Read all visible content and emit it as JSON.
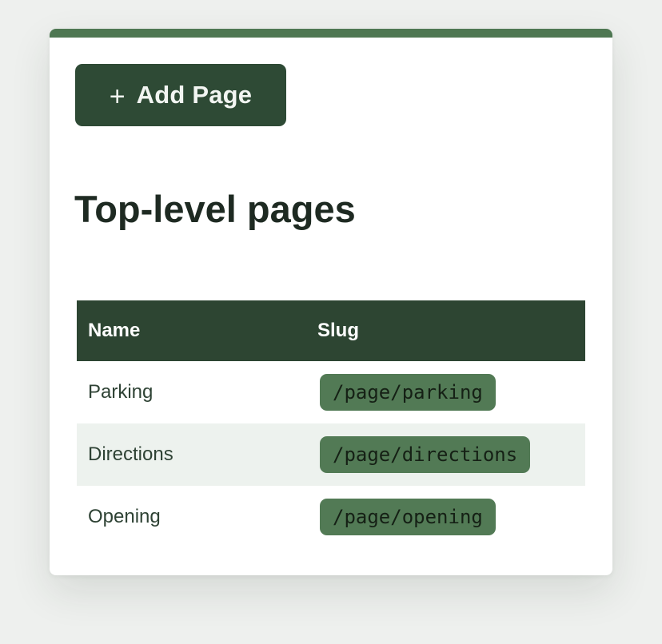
{
  "toolbar": {
    "add_icon": "plus-icon",
    "add_icon_glyph": "+",
    "add_label": "Add Page"
  },
  "section": {
    "title": "Top-level pages"
  },
  "table": {
    "columns": [
      "Name",
      "Slug"
    ],
    "rows": [
      {
        "name": "Parking",
        "slug": "/page/parking"
      },
      {
        "name": "Directions",
        "slug": "/page/directions"
      },
      {
        "name": "Opening",
        "slug": "/page/opening"
      }
    ]
  },
  "colors": {
    "accent": "#4e7752",
    "button_bg": "#2e4a35",
    "header_bg": "#2d4532",
    "pill_bg": "#527a55",
    "row_alt": "#edf2ee"
  }
}
